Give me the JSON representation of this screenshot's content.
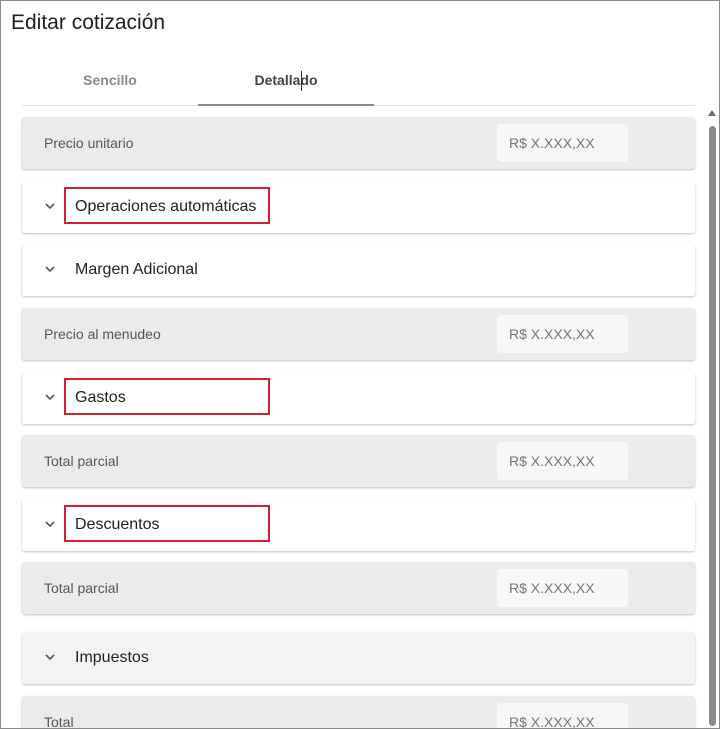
{
  "dialog": {
    "title": "Editar cotización"
  },
  "tabs": [
    {
      "label": "Sencillo",
      "active": false
    },
    {
      "label": "Detallado",
      "active": true
    }
  ],
  "rows": {
    "precio_unitario": {
      "label": "Precio unitario",
      "placeholder": "R$ X.XXX,XX"
    },
    "operaciones": {
      "label": "Operaciones automáticas",
      "icon": "chevron-down-icon",
      "highlighted": true
    },
    "margen": {
      "label": "Margen Adicional",
      "icon": "chevron-down-icon"
    },
    "precio_menudeo": {
      "label": "Precio al menudeo",
      "placeholder": "R$ X.XXX,XX"
    },
    "gastos": {
      "label": "Gastos",
      "icon": "chevron-down-icon",
      "highlighted": true
    },
    "total_parcial_1": {
      "label": "Total parcial",
      "placeholder": "R$ X.XXX,XX"
    },
    "descuentos": {
      "label": "Descuentos",
      "icon": "chevron-down-icon",
      "highlighted": true
    },
    "total_parcial_2": {
      "label": "Total parcial",
      "placeholder": "R$ X.XXX,XX"
    },
    "impuestos": {
      "label": "Impuestos",
      "icon": "chevron-down-icon"
    },
    "total": {
      "label": "Total",
      "placeholder": "R$ X.XXX,XX"
    }
  },
  "colors": {
    "highlight": "#d32030",
    "active_tab_underline": "#8a8a8a",
    "price_row_bg": "#ebebeb"
  }
}
